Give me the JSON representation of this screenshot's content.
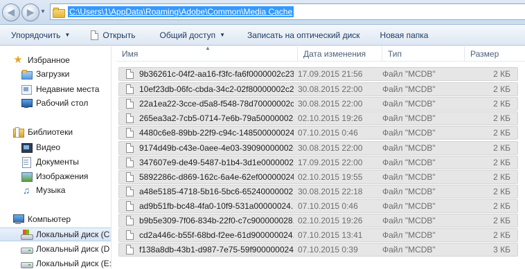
{
  "address": {
    "path": "C:\\Users\\1\\AppData\\Roaming\\Adobe\\Common\\Media Cache",
    "folder_icon": "folder-icon"
  },
  "toolbar": {
    "organize": "Упорядочить",
    "open": "Открыть",
    "share": "Общий доступ",
    "burn": "Записать на оптический диск",
    "new_folder": "Новая папка"
  },
  "nav": {
    "favorites": "Избранное",
    "downloads": "Загрузки",
    "recent": "Недавние места",
    "desktop": "Рабочий стол",
    "libraries": "Библиотеки",
    "video": "Видео",
    "documents": "Документы",
    "images": "Изображения",
    "music": "Музыка",
    "computer": "Компьютер",
    "disk_c": "Локальный диск (C",
    "disk_d": "Локальный диск (D",
    "disk_e": "Локальный диск (E:"
  },
  "columns": {
    "name": "Имя",
    "date": "Дата изменения",
    "type": "Тип",
    "size": "Размер"
  },
  "files": [
    {
      "name": "9b36261c-04f2-aa16-f3fc-fa6f0000002c23...",
      "date": "17.09.2015 21:56",
      "type": "Файл \"MCDB\"",
      "size": "2 КБ"
    },
    {
      "name": "10ef23db-06fc-cbda-34c2-02f80000002c2...",
      "date": "30.08.2015 22:00",
      "type": "Файл \"MCDB\"",
      "size": "2 КБ"
    },
    {
      "name": "22a1ea22-3cce-d5a8-f548-78d70000002c...",
      "date": "30.08.2015 22:00",
      "type": "Файл \"MCDB\"",
      "size": "2 КБ"
    },
    {
      "name": "265ea3a2-7cb5-0714-7e6b-79a500000028...",
      "date": "02.10.2015 19:26",
      "type": "Файл \"MCDB\"",
      "size": "2 КБ"
    },
    {
      "name": "4480c6e8-89bb-22f9-c94c-148500000024...",
      "date": "07.10.2015 0:46",
      "type": "Файл \"MCDB\"",
      "size": "2 КБ"
    },
    {
      "name": "9174d49b-c43e-0aee-4e03-39090000002c...",
      "date": "30.08.2015 22:00",
      "type": "Файл \"MCDB\"",
      "size": "2 КБ"
    },
    {
      "name": "347607e9-de49-5487-b1b4-3d1e0000002c...",
      "date": "17.09.2015 22:00",
      "type": "Файл \"MCDB\"",
      "size": "2 КБ"
    },
    {
      "name": "5892286c-d869-162c-6a4e-62ef00000024...",
      "date": "02.10.2015 19:55",
      "type": "Файл \"MCDB\"",
      "size": "2 КБ"
    },
    {
      "name": "a48e5185-4718-5b16-5bc6-65240000002...",
      "date": "30.08.2015 22:18",
      "type": "Файл \"MCDB\"",
      "size": "2 КБ"
    },
    {
      "name": "ad9b51fb-bc48-4fa0-10f9-531a00000024...",
      "date": "07.10.2015 0:46",
      "type": "Файл \"MCDB\"",
      "size": "2 КБ"
    },
    {
      "name": "b9b5e309-7f06-834b-22f0-c7c900000028...",
      "date": "02.10.2015 19:26",
      "type": "Файл \"MCDB\"",
      "size": "2 КБ"
    },
    {
      "name": "cd2a446c-b55f-68bd-f2ee-61d900000024...",
      "date": "07.10.2015 13:41",
      "type": "Файл \"MCDB\"",
      "size": "2 КБ"
    },
    {
      "name": "f138a8db-43b1-d987-7e75-59f900000024...",
      "date": "07.10.2015 0:39",
      "type": "Файл \"MCDB\"",
      "size": "3 КБ"
    }
  ]
}
